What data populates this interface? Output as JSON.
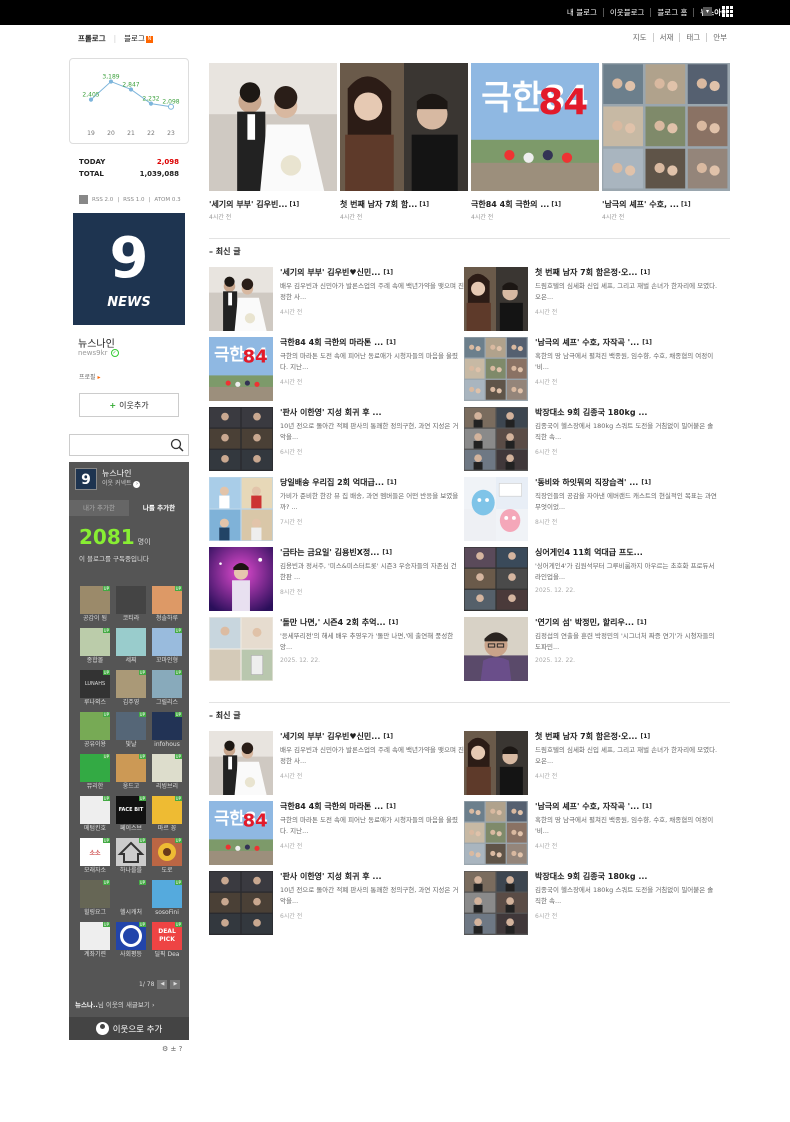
{
  "topbar": {
    "links": [
      "내 블로그",
      "이웃블로그",
      "블로그 홈",
      "뉴스아이"
    ],
    "dropdown_icon": "▾"
  },
  "subnav": {
    "prologue": "프롤로그",
    "blog": "블로그",
    "blog_badge": "N",
    "right_links": [
      "지도",
      "서재",
      "태그",
      "안부"
    ]
  },
  "visits": {
    "days": [
      "19",
      "20",
      "21",
      "22",
      "23"
    ],
    "values": [
      "2,405",
      "3,189",
      "2,847",
      "2,232",
      "2,098"
    ],
    "values_num": [
      2405,
      3189,
      2847,
      2232,
      2098
    ],
    "today_label": "TODAY",
    "today_value": "2,098",
    "total_label": "TOTAL",
    "total_value": "1,039,088"
  },
  "rss": [
    "RSS 2.0",
    "RSS 1.0",
    "ATOM 0.3"
  ],
  "profile": {
    "logo_main": "9",
    "logo_sub": "NEWS",
    "name": "뉴스나인",
    "id": "news9kr",
    "link": "프로필",
    "follow_label": "이웃추가"
  },
  "search": {
    "placeholder": ""
  },
  "neighbors": {
    "blog_name": "뉴스나인",
    "subtitle": "이웃 커넥트",
    "tab_inactive": "내가 추가한",
    "tab_active": "나를 추가한",
    "count": "2081",
    "count_unit": "명이",
    "desc": "이 블로그를 구독중입니다",
    "items": [
      {
        "label": "공감이 됨",
        "color": "#9b8a6a"
      },
      {
        "label": "코티라",
        "color": "#444"
      },
      {
        "label": "청솔하루",
        "color": "#d96"
      },
      {
        "label": "종합몰",
        "color": "#bca"
      },
      {
        "label": "세찌",
        "color": "#9cc"
      },
      {
        "label": "꼬마인형",
        "color": "#9bd"
      },
      {
        "label": "루나외스",
        "color": "#333"
      },
      {
        "label": "김주영",
        "color": "#a97"
      },
      {
        "label": "그릴리스",
        "color": "#8ab"
      },
      {
        "label": "공유이용",
        "color": "#7a5"
      },
      {
        "label": "빛날",
        "color": "#567"
      },
      {
        "label": "infohous",
        "color": "#235"
      },
      {
        "label": "뮤리한",
        "color": "#3a4"
      },
      {
        "label": "웅드고",
        "color": "#c95"
      },
      {
        "label": "리빙브리",
        "color": "#ddc"
      },
      {
        "label": "메텀킨호",
        "color": "#eee"
      },
      {
        "label": "페이스브",
        "color": "#111"
      },
      {
        "label": "마르 꽁",
        "color": "#eb3"
      },
      {
        "label": "모래자소",
        "color": "#fff"
      },
      {
        "label": "하나를를",
        "color": "#ccc"
      },
      {
        "label": "도로",
        "color": "#b64"
      },
      {
        "label": "힐링요그",
        "color": "#665"
      },
      {
        "label": "헬시캐처",
        "color": "#555"
      },
      {
        "label": "sosoFini",
        "color": "#5ad"
      },
      {
        "label": "계좌기련",
        "color": "#eee"
      },
      {
        "label": "사회평등",
        "color": "#24a"
      },
      {
        "label": "딜픽 Dea",
        "color": "#e44"
      }
    ],
    "logo_texts": {
      "deal": "DEAL PICK",
      "luna": "LUNAHS",
      "face": "FACE BIT",
      "soso": "소소"
    },
    "pager": "1/ 78",
    "pager_prev": "◀",
    "pager_next": "▶",
    "feed_name": "뉴스나..",
    "feed_text": "님 이웃의 새글보기",
    "add_label": "이웃으로 추가",
    "footer": "⚙ ± ?"
  },
  "featured": [
    {
      "title": "'세기의 부부' 김우빈...",
      "comments": "[1]",
      "time": "4시간 전",
      "img": "wedding"
    },
    {
      "title": "첫 번째 남자 7회 함...",
      "comments": "[1]",
      "time": "4시간 전",
      "img": "drama"
    },
    {
      "title": "극한84 4회 극한의 ...",
      "comments": "[1]",
      "time": "4시간 전",
      "img": "poster"
    },
    {
      "title": "'남극의 셰프' 수호, ...",
      "comments": "[1]",
      "time": "4시간 전",
      "img": "collage"
    }
  ],
  "sections": [
    {
      "title": "최신 글",
      "posts": [
        {
          "title": "'세기의 부부' 김우빈♥신민...",
          "comments": "[1]",
          "desc": "배우 김우빈과 신민아가 발론스업의 주례 속에 백년가약을 맺으며 진정한 사...",
          "time": "4시간 전",
          "img": "wedding"
        },
        {
          "title": "첫 번째 남자 7회 함은정·오...",
          "comments": "[1]",
          "desc": "드림호텔의 심세화 신입 셰프, 그리고 재벌 손녀가 한자리에 모였다. 오은...",
          "time": "4시간 전",
          "img": "drama"
        },
        {
          "title": "극한84 4회 극한의 마라톤 ...",
          "comments": "[1]",
          "desc": "극한의 마라톤 도전 속에 피어난 동료애가 시청자들의 마음을 울렸다. 지난...",
          "time": "4시간 전",
          "img": "poster"
        },
        {
          "title": "'남극의 셰프' 수호, 자작곡 '...",
          "comments": "[1]",
          "desc": "혹한의 땅 남극에서 펼쳐진 백종원, 임수향, 수호, 채종협의 여정이 '비...",
          "time": "4시간 전",
          "img": "collage"
        },
        {
          "title": "'판사 이한영' 지성 회귀 후 ...",
          "comments": "",
          "desc": "10년 전으로 돌아간 적폐 판사의 통쾌한 정의구현, 과연 지성은 거악을...",
          "time": "6시간 전",
          "img": "dark"
        },
        {
          "title": "박장대소 9회 김종국 180kg ...",
          "comments": "",
          "desc": "김종국이 헬스장에서 180kg 스쿼트 도전을 거침없이 밀어붙은 솔직한 속...",
          "time": "6시간 전",
          "img": "gym"
        },
        {
          "title": "당일배송 우리집 2회 억대급...",
          "comments": "[1]",
          "desc": "가비가 준비한 한강 뷰 집 배송, 과연 멤버들은 어떤 반응을 보였을까? ...",
          "time": "7시간 전",
          "img": "beach"
        },
        {
          "title": "'동비와 하잇뭐의 직장습격' ...",
          "comments": "[1]",
          "desc": "직장인들의 공감을 자아낸 에버랜드 캐스트의 현실적인 목표는 과연 무엇이었...",
          "time": "8시간 전",
          "img": "cartoon"
        },
        {
          "title": "'금타는 금요일' 김용빈X정...",
          "comments": "[1]",
          "desc": "김용빈과 정서주, '미스&미스터트롯' 시즌3 우승자들의 자존심 건 한판 ...",
          "time": "8시간 전",
          "img": "stage"
        },
        {
          "title": "싱어게인4 11회 억대급 프도...",
          "comments": "",
          "desc": "'싱어게인4'가 김원석부터 그루비룸까지 아우르는 초호화 프로듀서 라인업을...",
          "time": "2025. 12. 22.",
          "img": "singer"
        },
        {
          "title": "'돌만 나면,' 시즌4 2회 추억...",
          "comments": "[1]",
          "desc": "'응세뚜리전'의 해세 배우 추영우가 '돌만 나면,'에 출연해 풍성한 앙...",
          "time": "2025. 12. 22.",
          "img": "travel"
        },
        {
          "title": "'연기의 섬' 박정민, 할리우...",
          "comments": "[1]",
          "desc": "김정섭의 연출을 훈련 박정민의 '시그너처 짜증 연기'가 시청자들의 도파민...",
          "time": "2025. 12. 22.",
          "img": "man"
        }
      ]
    },
    {
      "title": "최신 글",
      "posts": [
        {
          "title": "'세기의 부부' 김우빈♥신민...",
          "comments": "[1]",
          "desc": "배우 김우빈과 신민아가 발론스업의 주례 속에 백년가약을 맺으며 진정한 사...",
          "time": "4시간 전",
          "img": "wedding"
        },
        {
          "title": "첫 번째 남자 7회 함은정·오...",
          "comments": "[1]",
          "desc": "드림호텔의 심세화 신입 셰프, 그리고 재벌 손녀가 한자리에 모였다. 오은...",
          "time": "4시간 전",
          "img": "drama"
        },
        {
          "title": "극한84 4회 극한의 마라톤 ...",
          "comments": "[1]",
          "desc": "극한의 마라톤 도전 속에 피어난 동료애가 시청자들의 마음을 울렸다. 지난...",
          "time": "4시간 전",
          "img": "poster"
        },
        {
          "title": "'남극의 셰프' 수호, 자작곡 '...",
          "comments": "[1]",
          "desc": "혹한의 땅 남극에서 펼쳐진 백종원, 임수향, 수호, 채종협의 여정이 '비...",
          "time": "4시간 전",
          "img": "collage"
        },
        {
          "title": "'판사 이한영' 지성 회귀 후 ...",
          "comments": "",
          "desc": "10년 전으로 돌아간 적폐 판사의 통쾌한 정의구현, 과연 지성은 거악을...",
          "time": "6시간 전",
          "img": "dark"
        },
        {
          "title": "박장대소 9회 김종국 180kg ...",
          "comments": "",
          "desc": "김종국이 헬스장에서 180kg 스쿼트 도전을 거침없이 밀어붙은 솔직한 속...",
          "time": "6시간 전",
          "img": "gym"
        }
      ]
    }
  ],
  "poster_text": "극한84"
}
